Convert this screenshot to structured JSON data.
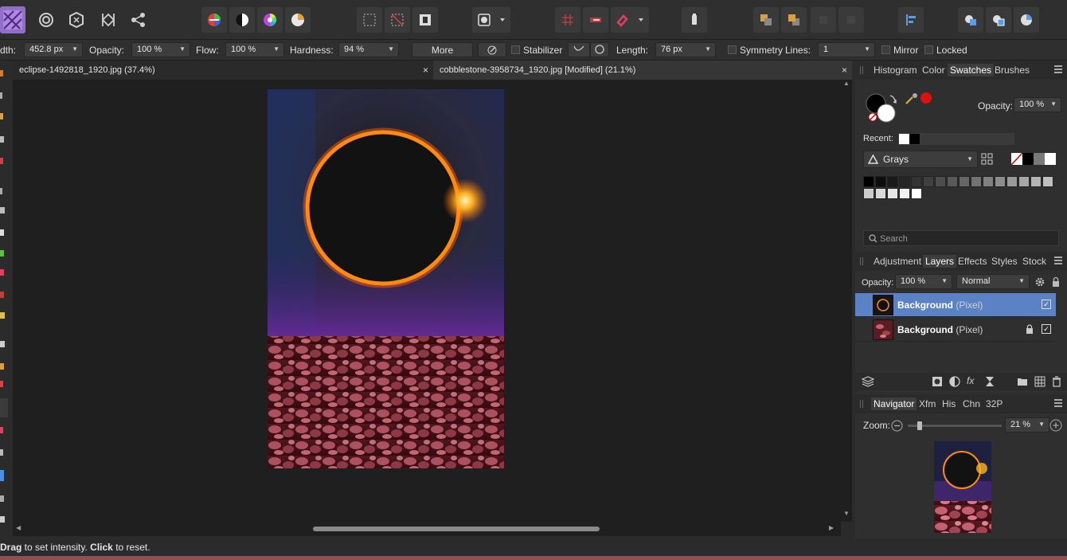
{
  "context_bar": {
    "width_label": "dth:",
    "width_value": "452.8 px",
    "opacity_label": "Opacity:",
    "opacity_value": "100 %",
    "flow_label": "Flow:",
    "flow_value": "100 %",
    "hardness_label": "Hardness:",
    "hardness_value": "94 %",
    "more_label": "More",
    "stabilizer_label": "Stabilizer",
    "length_label": "Length:",
    "length_value": "76 px",
    "symmetry_label": "Symmetry",
    "lines_label": "Lines:",
    "lines_value": "1",
    "mirror_label": "Mirror",
    "locked_label": "Locked"
  },
  "tabs": [
    {
      "label": "eclipse-1492818_1920.jpg (37.4%)",
      "close": "×"
    },
    {
      "label": "cobblestone-3958734_1920.jpg [Modified] (21.1%)",
      "close": "×"
    }
  ],
  "swatches_panel": {
    "tabs": [
      "Histogram",
      "Color",
      "Swatches",
      "Brushes"
    ],
    "active_tab": "Swatches",
    "opacity_label": "Opacity:",
    "opacity_value": "100 %",
    "recent_label": "Recent:",
    "palette_name": "Grays",
    "search_placeholder": "Search",
    "gray_swatches": [
      "#000000",
      "#0d0d0d",
      "#1a1a1a",
      "#262626",
      "#333333",
      "#404040",
      "#4d4d4d",
      "#595959",
      "#666666",
      "#737373",
      "#808080",
      "#8c8c8c",
      "#999999",
      "#a6a6a6",
      "#b3b3b3",
      "#bfbfbf",
      "#cccccc",
      "#d9d9d9",
      "#e6e6e6",
      "#f2f2f2",
      "#ffffff"
    ]
  },
  "layers_panel": {
    "tabs": [
      "Adjustment",
      "Layers",
      "Effects",
      "Styles",
      "Stock"
    ],
    "active_tab": "Layers",
    "opacity_label": "Opacity:",
    "opacity_value": "100 %",
    "blend_mode": "Normal",
    "layers": [
      {
        "name": "Background",
        "kind": "(Pixel)",
        "selected": true,
        "locked": false
      },
      {
        "name": "Background",
        "kind": "(Pixel)",
        "selected": false,
        "locked": true
      }
    ]
  },
  "navigator_panel": {
    "tabs": [
      "Navigator",
      "Xfm",
      "His",
      "Chn",
      "32P"
    ],
    "active_tab": "Navigator",
    "zoom_label": "Zoom:",
    "zoom_value": "21 %",
    "zoom_level": 0.21
  },
  "status": {
    "drag_word": "Drag",
    "drag_rest": " to set intensity. ",
    "click_word": "Click",
    "click_rest": " to reset."
  },
  "colors": {
    "accent": "#5b82c4",
    "primary_color": "#000000",
    "secondary_color": "#ffffff",
    "red_swatch": "#e01010"
  }
}
